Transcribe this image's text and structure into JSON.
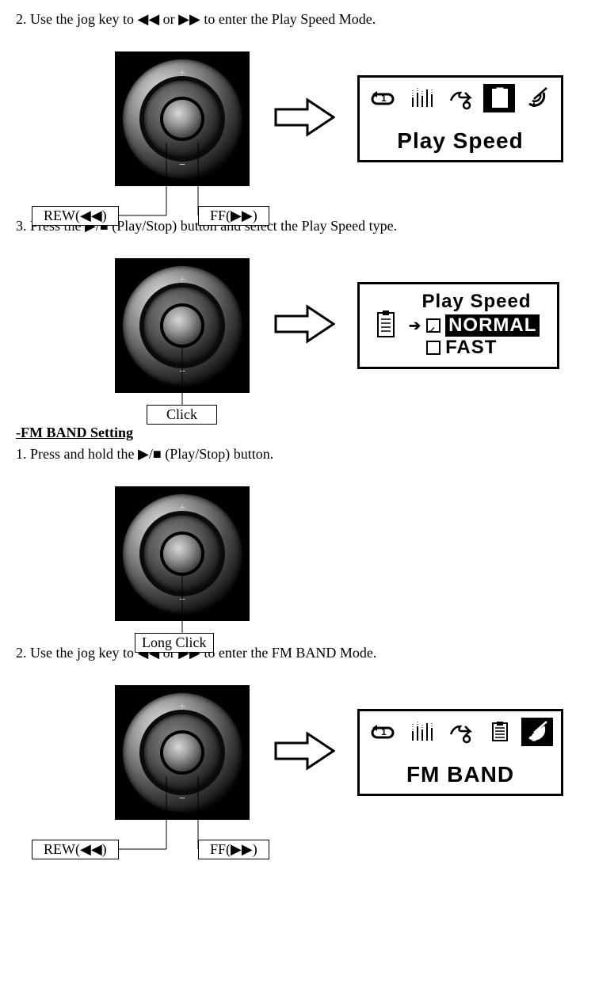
{
  "steps": {
    "s2a": "2. Use the jog key to ◀◀ or ▶▶ to enter the Play Speed Mode.",
    "s3": "3. Press the ▶/■ (Play/Stop) button and select the Play Speed type.",
    "fm_heading": "-FM BAND Setting",
    "fm1": "1. Press and hold the ▶/■ (Play/Stop) button.",
    "fm2": "2. Use the jog key to ◀◀ or ▶▶ to enter the FM BAND Mode."
  },
  "labels": {
    "rew": "REW(◀◀)",
    "ff": "FF(▶▶)",
    "click": "Click",
    "long_click": "Long Click"
  },
  "lcd": {
    "play_speed_menu": "Play Speed",
    "fm_band_menu": "FM BAND",
    "play_speed_detail": {
      "title": "Play Speed",
      "options": [
        {
          "label": "NORMAL",
          "selected": true
        },
        {
          "label": "FAST",
          "selected": false
        }
      ]
    }
  },
  "icons": {
    "repeat": "repeat-1-icon",
    "eq": "equalizer-icon",
    "speed": "speed-icon",
    "clipboard": "clipboard-icon",
    "antenna": "antenna-dish-icon",
    "selected_playspeed": "clipboard",
    "selected_fmband": "antenna"
  }
}
